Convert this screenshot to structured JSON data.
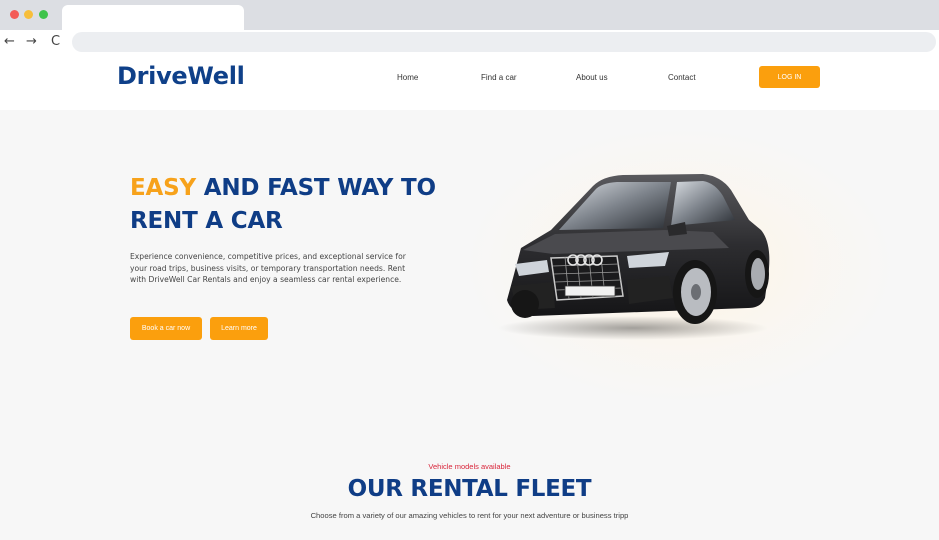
{
  "browser": {
    "nav": {
      "back": "←",
      "forward": "→",
      "reload": "C"
    }
  },
  "header": {
    "logo": "DriveWell",
    "nav": [
      {
        "label": "Home"
      },
      {
        "label": "Find a car"
      },
      {
        "label": "About us"
      },
      {
        "label": "Contact"
      }
    ],
    "login_label": "LOG IN"
  },
  "hero": {
    "title_accent": "EASY",
    "title_rest": " AND FAST WAY TO RENT A CAR",
    "description": "Experience convenience, competitive prices, and exceptional service for your road trips, business visits, or temporary transportation needs. Rent with DriveWell Car Rentals and enjoy a seamless car rental experience.",
    "buttons": {
      "primary": "Book a car now",
      "secondary": "Learn more"
    }
  },
  "fleet": {
    "eyebrow": "Vehicle models available",
    "title": "OUR RENTAL FLEET",
    "subtitle": "Choose from a variety of our amazing vehicles to rent for your next adventure or business tripp"
  },
  "colors": {
    "brand_blue": "#0f3d86",
    "accent_orange": "#fb9f0d",
    "eyebrow_red": "#d9263b",
    "hero_bg": "#f7f7f7"
  },
  "icons": {
    "car": "suv-car-illustration"
  }
}
